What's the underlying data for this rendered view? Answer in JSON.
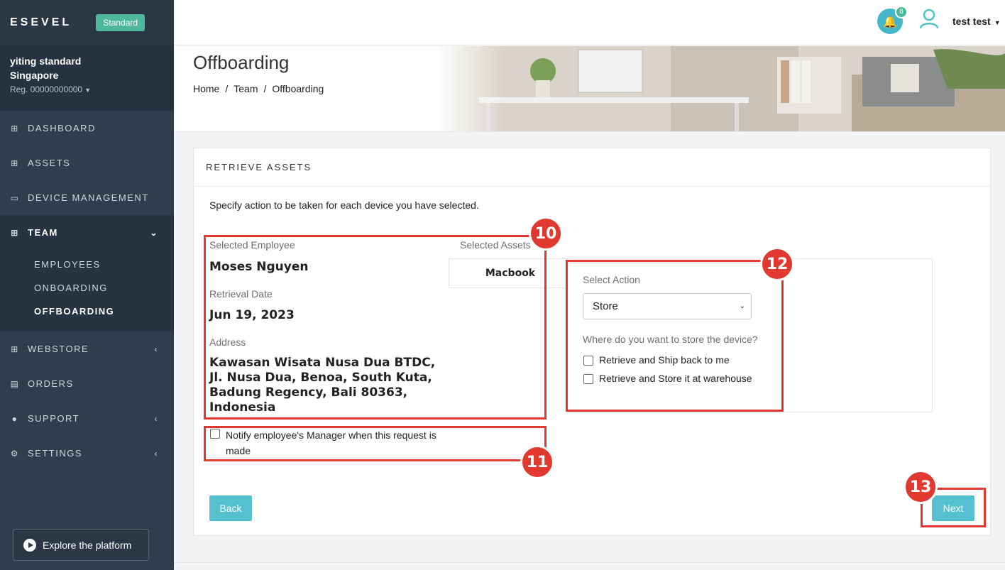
{
  "sidebar": {
    "logo": "ESEVEL",
    "plan": "Standard",
    "company_line1": "yiting standard",
    "company_line2": "Singapore",
    "reg": "Reg. 00000000000",
    "nav": [
      {
        "label": "DASHBOARD",
        "icon": "grid-icon"
      },
      {
        "label": "ASSETS",
        "icon": "grid-icon"
      },
      {
        "label": "DEVICE MANAGEMENT",
        "icon": "laptop-icon"
      },
      {
        "label": "TEAM",
        "icon": "grid-icon"
      },
      {
        "label": "WEBSTORE",
        "icon": "grid-icon"
      },
      {
        "label": "ORDERS",
        "icon": "document-icon"
      },
      {
        "label": "SUPPORT",
        "icon": "info-icon"
      },
      {
        "label": "SETTINGS",
        "icon": "users-gear-icon"
      }
    ],
    "team_sub": [
      "EMPLOYEES",
      "ONBOARDING",
      "OFFBOARDING"
    ],
    "explore": "Explore the platform"
  },
  "topbar": {
    "notification_count": "8",
    "user_name": "test test"
  },
  "header": {
    "title": "Offboarding",
    "breadcrumb": [
      "Home",
      "Team",
      "Offboarding"
    ]
  },
  "card": {
    "title": "RETRIEVE ASSETS",
    "instruction": "Specify action to be taken for each device you have selected.",
    "employee_label": "Selected Employee",
    "employee_name": "Moses Nguyen",
    "date_label": "Retrieval Date",
    "date_value": "Jun 19, 2023",
    "address_label": "Address",
    "address_value": "Kawasan Wisata Nusa Dua BTDC, Jl. Nusa Dua, Benoa, South Kuta, Badung Regency, Bali 80363, Indonesia",
    "assets_label": "Selected Assets",
    "asset_name": "Macbook",
    "action_label": "Select Action",
    "action_value": "Store",
    "store_question": "Where do you want to store the device?",
    "option_ship": "Retrieve and Ship back to me",
    "option_warehouse": "Retrieve and Store it at warehouse",
    "notify_text": "Notify employee's Manager when this request is made",
    "back": "Back",
    "next": "Next"
  },
  "annotations": {
    "step10": "10",
    "step11": "11",
    "step12": "12",
    "step13": "13",
    "color": "#e1392f"
  },
  "colors": {
    "sidebar": "#2f3e4d",
    "accent": "#55c0cf",
    "badge": "#4db89a"
  }
}
